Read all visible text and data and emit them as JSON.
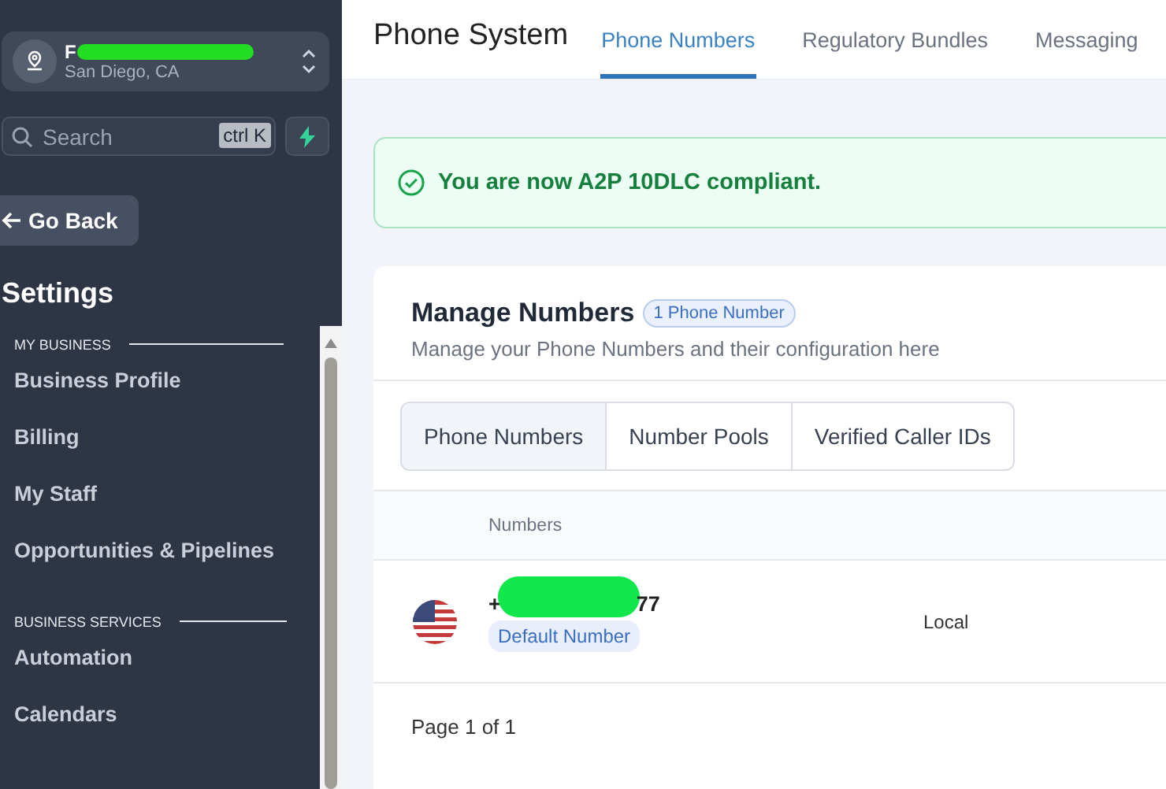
{
  "location": {
    "name": "F",
    "city": "San Diego, CA"
  },
  "search": {
    "placeholder": "Search",
    "shortcut": "ctrl K"
  },
  "back_button": "Go Back",
  "sidebar_title": "Settings",
  "sidebar_sections": [
    {
      "heading": "MY BUSINESS",
      "items": [
        {
          "label": "Business Profile",
          "selected": false
        },
        {
          "label": "Billing",
          "selected": false
        },
        {
          "label": "My Staff",
          "selected": false
        },
        {
          "label": "Opportunities & Pipelines",
          "selected": false
        }
      ]
    },
    {
      "heading": "BUSINESS SERVICES",
      "items": [
        {
          "label": "Automation",
          "selected": false
        },
        {
          "label": "Calendars",
          "selected": false
        }
      ]
    }
  ],
  "page_title": "Phone System",
  "tabs": [
    {
      "label": "Phone Numbers",
      "selected": true
    },
    {
      "label": "Regulatory Bundles",
      "selected": false
    },
    {
      "label": "Messaging",
      "selected": false
    }
  ],
  "banner": "You are now A2P 10DLC compliant.",
  "card": {
    "title": "Manage Numbers",
    "badge": "1 Phone Number",
    "subtitle": "Manage your Phone Numbers and their configuration here",
    "segments": [
      {
        "label": "Phone Numbers",
        "selected": true
      },
      {
        "label": "Number Pools",
        "selected": false
      },
      {
        "label": "Verified Caller IDs",
        "selected": false
      }
    ],
    "table": {
      "columns": [
        "Numbers"
      ],
      "rows": [
        {
          "number_start": "+",
          "number_end": "77",
          "tag": "Default Number",
          "type": "Local"
        }
      ]
    },
    "pagination": "Page 1 of 1"
  }
}
